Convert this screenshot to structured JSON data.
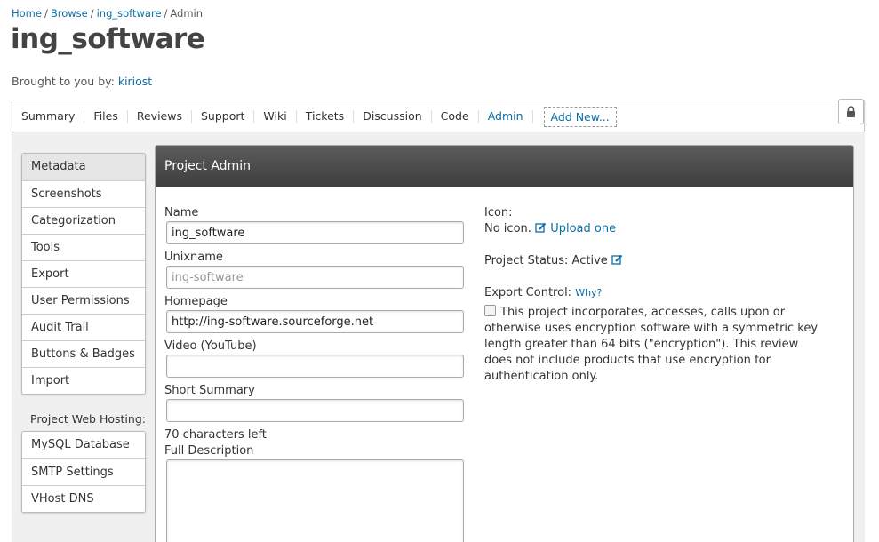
{
  "breadcrumb": {
    "home": "Home",
    "browse": "Browse",
    "project": "ing_software",
    "current": "Admin"
  },
  "page_title": "ing_software",
  "byline": {
    "prefix": "Brought to you by:",
    "user": "kiriost"
  },
  "nav": {
    "tabs": [
      "Summary",
      "Files",
      "Reviews",
      "Support",
      "Wiki",
      "Tickets",
      "Discussion",
      "Code",
      "Admin"
    ],
    "active": "Admin",
    "add_new": "Add New..."
  },
  "sidebar": {
    "items": [
      "Metadata",
      "Screenshots",
      "Categorization",
      "Tools",
      "Export",
      "User Permissions",
      "Audit Trail",
      "Buttons & Badges",
      "Import"
    ],
    "selected": "Metadata",
    "hosting_heading": "Project Web Hosting:",
    "hosting_items": [
      "MySQL Database",
      "SMTP Settings",
      "VHost DNS"
    ]
  },
  "panel": {
    "title": "Project Admin"
  },
  "form": {
    "name_label": "Name",
    "name_value": "ing_software",
    "unixname_label": "Unixname",
    "unixname_value": "ing-software",
    "homepage_label": "Homepage",
    "homepage_value": "http://ing-software.sourceforge.net",
    "video_label": "Video (YouTube)",
    "video_value": "",
    "summary_label": "Short Summary",
    "summary_value": "",
    "chars_left": "70 characters left",
    "description_label": "Full Description"
  },
  "right": {
    "icon_label": "Icon:",
    "icon_status": "No icon.",
    "upload_link": "Upload one",
    "status_label": "Project Status: Active",
    "export_label": "Export Control:",
    "export_why": "Why?",
    "export_text": "This project incorporates, accesses, calls upon or otherwise uses encryption software with a symmetric key length greater than 64 bits (\"encryption\"). This review does not include products that use encryption for authentication only."
  },
  "colors": {
    "link": "#0c6ea6",
    "header_dark": "#4a4a4a"
  },
  "icons": {
    "lock": "lock-icon",
    "edit": "edit-icon"
  }
}
